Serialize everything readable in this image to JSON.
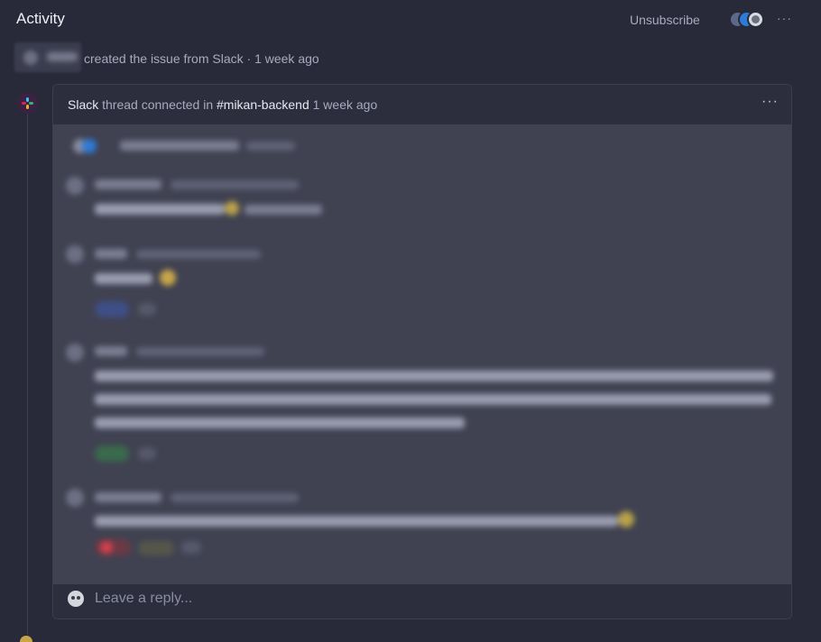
{
  "header": {
    "title": "Activity",
    "unsubscribe_label": "Unsubscribe",
    "more_label": "···"
  },
  "created": {
    "text": "created the issue from Slack · 1 week ago"
  },
  "card": {
    "source": "Slack",
    "connected_text": "thread connected in",
    "channel": "#mikan-backend",
    "time": "1 week ago",
    "more_label": "···"
  },
  "reply": {
    "placeholder": "Leave a reply..."
  },
  "icons": {
    "slack": "slack-icon",
    "more": "more-horizontal-icon"
  },
  "colors": {
    "background": "#282a3a",
    "card": "#2c2e3e",
    "thread": "#404252",
    "slack_accent": "#e01e5a"
  }
}
